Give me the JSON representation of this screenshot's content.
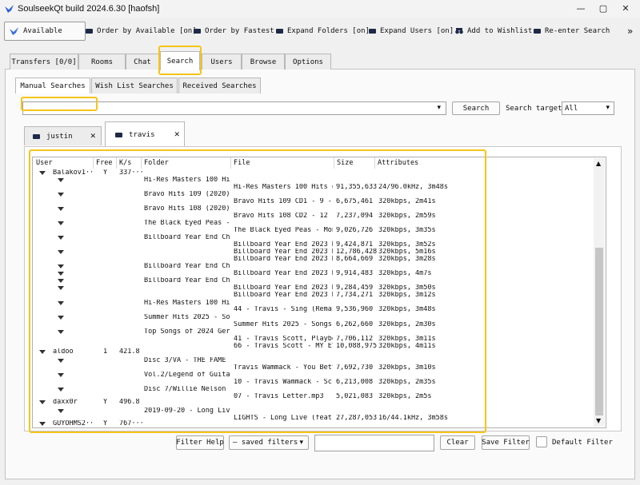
{
  "window": {
    "title": "SoulseekQt build 2024.6.30 [haofsh]"
  },
  "toolbar": {
    "available": "Available",
    "order_available": "Order by Available [on]",
    "order_fastest": "Order by Fastest",
    "expand_folders": "Expand Folders [on]",
    "expand_users": "Expand Users [on]",
    "add_wishlist": "Add to Wishlist",
    "reenter_search": "Re-enter Search",
    "overflow": "»"
  },
  "main_tabs": [
    "Transfers [0/0]",
    "Rooms",
    "Chat",
    "Search",
    "Users",
    "Browse",
    "Options"
  ],
  "search_tabs": [
    "Manual Searches",
    "Wish List Searches",
    "Received Searches"
  ],
  "search": {
    "query_value": "",
    "button": "Search",
    "target_label": "Search target:",
    "target_value": "All"
  },
  "query_tabs": [
    {
      "label": "justin",
      "close": "✕"
    },
    {
      "label": "travis",
      "close": "✕"
    }
  ],
  "results": {
    "columns": [
      "User",
      "Free",
      "K/s",
      "Folder",
      "File",
      "Size",
      "Attributes"
    ],
    "users": [
      {
        "name": "Balakov1···",
        "free": "Y",
        "speed": "337···"
      },
      {
        "name": "aldoo",
        "free": "1",
        "speed": "421.8"
      },
      {
        "name": "daxx0r",
        "free": "Y",
        "speed": "496.8"
      },
      {
        "name": "GUYOHMS2···",
        "free": "Y",
        "speed": "767···"
      }
    ],
    "folders": [
      "Hi-Res Masters 100 Hi···",
      "Bravo Hits 109 (2020)···",
      "Bravo Hits 108 (2020)···",
      "The Black Eyed Peas -···",
      "Billboard Year End Ch···",
      "Billboard Year End Ch···",
      "Billboard Year End Ch···",
      "Hi-Res Masters 100 Hi···",
      "Summer Hits 2025 - So···",
      "Top Songs of 2024 Ger···",
      "Disc 3/VA - THE FAME ···",
      "Vol.2/Legend of Guita···",
      "Disc 7/Willie Nelson ···",
      "2019-09-20 - Long Liv···"
    ],
    "files": [
      {
        "name": "Hi-Res Masters 100 Hits o···",
        "size": "91,355,633",
        "attr": "24/96.0kHz, 3m48s"
      },
      {
        "name": "Bravo Hits 109 CD1 - 9 - ···",
        "size": "6,675,461",
        "attr": "320kbps, 2m41s"
      },
      {
        "name": "Bravo Hits 108 CD2 - 12 -···",
        "size": "7,237,094",
        "attr": "320kbps, 2m59s"
      },
      {
        "name": "The Black Eyed Peas - Mon···",
        "size": "9,026,726",
        "attr": "320kbps, 3m35s"
      },
      {
        "name": "Billboard Year End 2023 H···",
        "size": "9,424,871",
        "attr": "320kbps, 3m52s"
      },
      {
        "name": "Billboard Year End 2023 H···",
        "size": "12,786,428",
        "attr": "320kbps, 5m16s"
      },
      {
        "name": "Billboard Year End 2023 H···",
        "size": "8,664,669",
        "attr": "320kbps, 3m28s"
      },
      {
        "name": "Billboard Year End 2023 H···",
        "size": "9,914,483",
        "attr": "320kbps, 4m7s"
      },
      {
        "name": "Billboard Year End 2023 H···",
        "size": "9,284,459",
        "attr": "320kbps, 3m50s"
      },
      {
        "name": "Billboard Year End 2023 H···",
        "size": "7,734,271",
        "attr": "320kbps, 3m12s"
      },
      {
        "name": "44 - Travis - Sing (Remas···",
        "size": "9,536,960",
        "attr": "320kbps, 3m48s"
      },
      {
        "name": "Summer Hits 2025 - Songs ···",
        "size": "6,262,660",
        "attr": "320kbps, 2m30s"
      },
      {
        "name": "41 - Travis Scott, Playbo···",
        "size": "7,706,112",
        "attr": "320kbps, 3m11s"
      },
      {
        "name": "66 - Travis Scott - MY EY···",
        "size": "10,088,975",
        "attr": "320kbps, 4m11s"
      },
      {
        "name": "Travis Wammack - You Bett···",
        "size": "7,692,730",
        "attr": "320kbps, 3m10s"
      },
      {
        "name": "10 - Travis Wammack - Scr···",
        "size": "6,213,008",
        "attr": "320kbps, 2m35s"
      },
      {
        "name": "07 - Travis Letter.mp3",
        "size": "5,021,083",
        "attr": "320kbps, 2m5s"
      },
      {
        "name": "LIGHTS - Long Live (feat.···",
        "size": "27,287,053",
        "attr": "16/44.1kHz, 3m58s"
      }
    ]
  },
  "filter": {
    "help": "Filter Help",
    "saved": "— saved filters",
    "input_value": "",
    "clear": "Clear",
    "save": "Save Filter",
    "default_label": "Default Filter"
  },
  "colors": {
    "highlight": "#f5c518",
    "icon": "#1e2a48"
  }
}
